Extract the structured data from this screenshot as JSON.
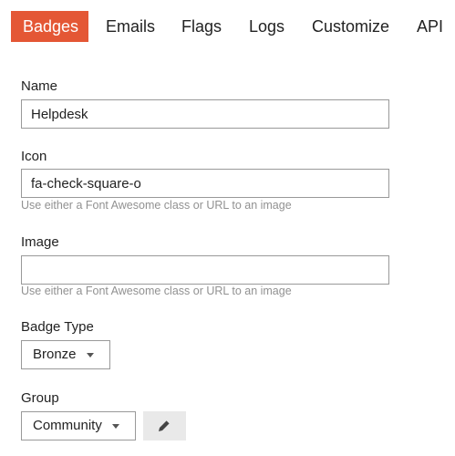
{
  "tabs": [
    {
      "label": "Badges",
      "active": true
    },
    {
      "label": "Emails",
      "active": false
    },
    {
      "label": "Flags",
      "active": false
    },
    {
      "label": "Logs",
      "active": false
    },
    {
      "label": "Customize",
      "active": false
    },
    {
      "label": "API",
      "active": false
    }
  ],
  "colors": {
    "accent": "#e45735",
    "help_text": "#919191",
    "button_bg": "#e9e9e9"
  },
  "form": {
    "name": {
      "label": "Name",
      "value": "Helpdesk"
    },
    "icon": {
      "label": "Icon",
      "value": "fa-check-square-o",
      "help": "Use either a Font Awesome class or URL to an image"
    },
    "image": {
      "label": "Image",
      "value": "",
      "help": "Use either a Font Awesome class or URL to an image"
    },
    "badge_type": {
      "label": "Badge Type",
      "selected": "Bronze"
    },
    "group": {
      "label": "Group",
      "selected": "Community",
      "edit_icon": "pencil-icon"
    }
  }
}
